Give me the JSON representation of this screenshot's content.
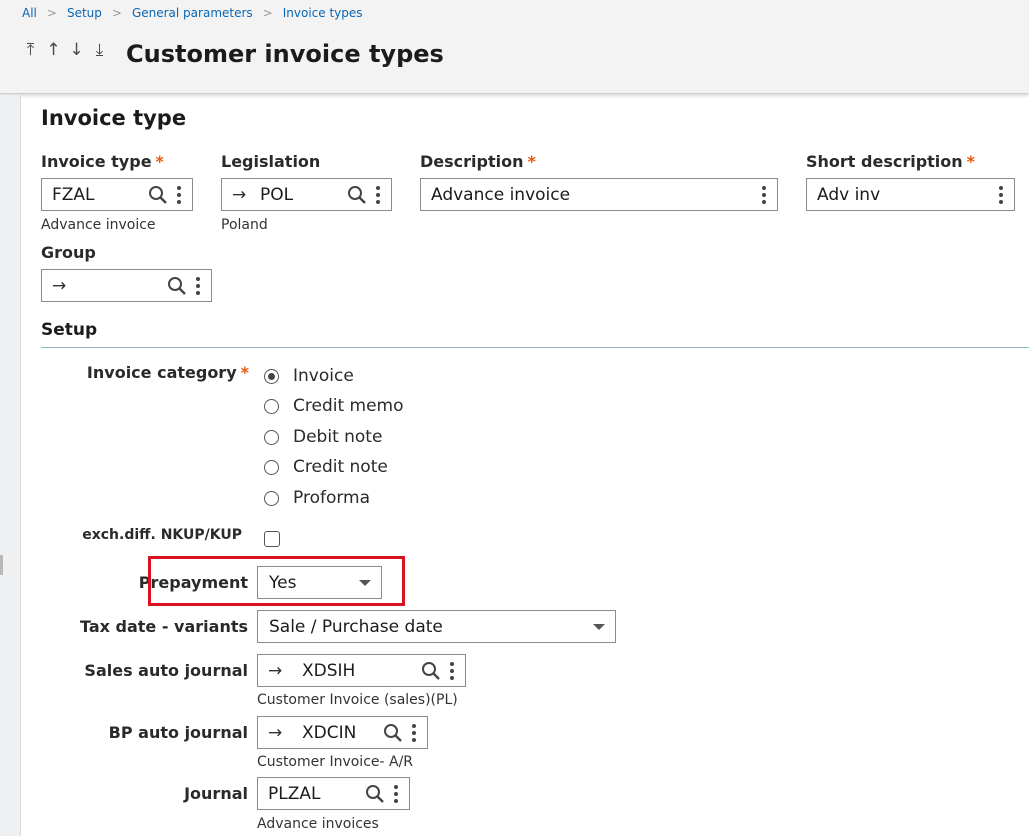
{
  "breadcrumb": [
    "All",
    "Setup",
    "General parameters",
    "Invoice types"
  ],
  "header": {
    "title": "Customer invoice types",
    "nav": [
      "⤒",
      "↑",
      "↓",
      "⤓"
    ]
  },
  "section": {
    "title": "Invoice type"
  },
  "fields": {
    "invoice_type": {
      "label": "Invoice type",
      "value": "FZAL",
      "sub": "Advance invoice"
    },
    "legislation": {
      "label": "Legislation",
      "value": "POL",
      "sub": "Poland"
    },
    "description": {
      "label": "Description",
      "value": "Advance invoice"
    },
    "short_description": {
      "label": "Short description",
      "value": "Adv inv"
    },
    "group": {
      "label": "Group",
      "value": ""
    }
  },
  "setup": {
    "title": "Setup",
    "invoice_category": {
      "label": "Invoice category",
      "options": [
        "Invoice",
        "Credit memo",
        "Debit note",
        "Credit note",
        "Proforma"
      ],
      "selected": "Invoice"
    },
    "exch_diff": {
      "label": "exch.diff. NKUP/KUP",
      "checked": false
    },
    "prepayment": {
      "label": "Prepayment",
      "value": "Yes"
    },
    "tax_date": {
      "label": "Tax date - variants",
      "value": "Sale / Purchase date"
    },
    "sales_auto_journal": {
      "label": "Sales auto journal",
      "value": "XDSIH",
      "sub": "Customer Invoice (sales)(PL)"
    },
    "bp_auto_journal": {
      "label": "BP auto journal",
      "value": "XDCIN",
      "sub": "Customer Invoice- A/R"
    },
    "journal": {
      "label": "Journal",
      "value": "PLZAL",
      "sub": "Advance invoices"
    }
  },
  "colors": {
    "link": "#0a66b3",
    "required": "#e8590c",
    "highlight": "#d8131f"
  },
  "required_marker": "*"
}
